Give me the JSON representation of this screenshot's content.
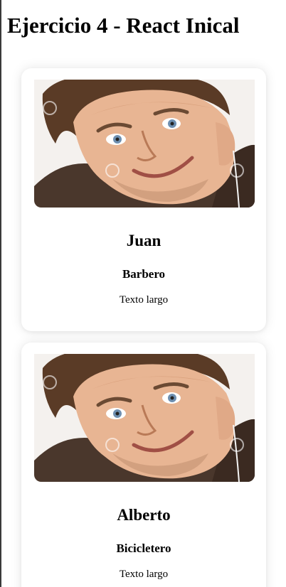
{
  "page": {
    "title": "Ejercicio 4 - React Inical"
  },
  "cards": [
    {
      "name": "Juan",
      "role": "Barbero",
      "description": "Texto largo",
      "photo_icon": "smiling-man-photo"
    },
    {
      "name": "Alberto",
      "role": "Bicicletero",
      "description": "Texto largo",
      "photo_icon": "smiling-man-photo"
    }
  ]
}
